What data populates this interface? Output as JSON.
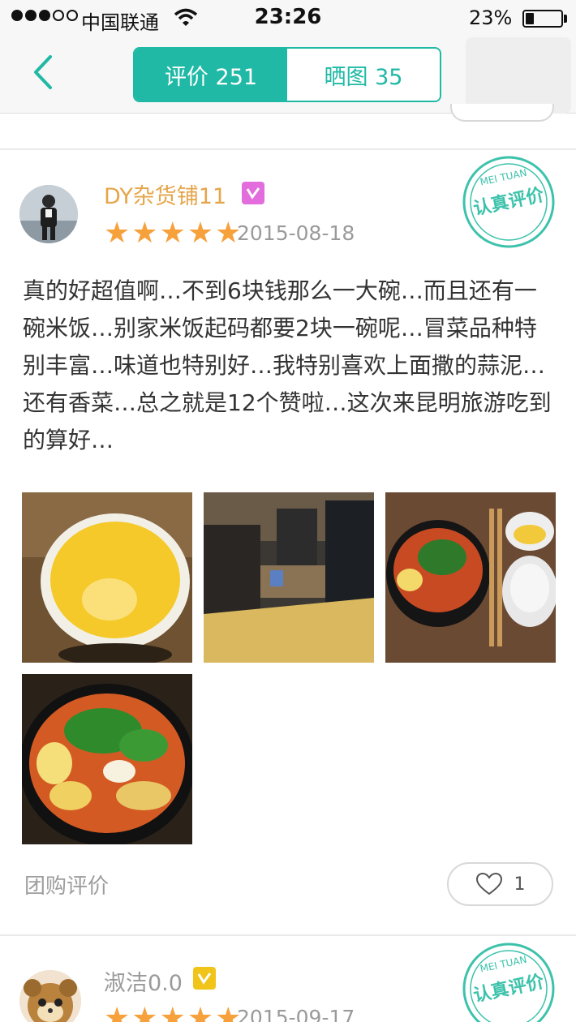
{
  "status_bar": {
    "carrier": "中国联通",
    "time": "23:26",
    "battery": "23%"
  },
  "nav": {
    "back_icon": "chevron-left-icon",
    "tabs": [
      {
        "label": "评价 251",
        "active": true
      },
      {
        "label": "晒图 35",
        "active": false
      }
    ]
  },
  "reviews": [
    {
      "username": "DY杂货铺11",
      "badge_color": "#e36ddc",
      "rating": 5,
      "date": "2015-08-18",
      "stamp_top": "MEI TUAN",
      "stamp_text": "认真评价",
      "text": "真的好超值啊…不到6块钱那么一大碗…而且还有一碗米饭…别家米饭起码都要2块一碗呢…冒菜品种特别丰富…味道也特别好…我特别喜欢上面撒的蒜泥…还有香菜…总之就是12个赞啦…这次来昆明旅游吃到的算好…",
      "photos": [
        "soup-cup-photo",
        "restaurant-interior-photo",
        "meal-set-photo",
        "maocai-bowl-photo"
      ],
      "source": "团购评价",
      "likes": "1"
    },
    {
      "username": "淑洁0.0",
      "badge_color": "#f0c419",
      "rating": 5,
      "date": "2015-09-17",
      "stamp_top": "MEI TUAN",
      "stamp_text": "认真评价"
    }
  ],
  "colors": {
    "accent": "#1fb9a5",
    "star": "#f6a13b",
    "username": "#e6a54a"
  }
}
